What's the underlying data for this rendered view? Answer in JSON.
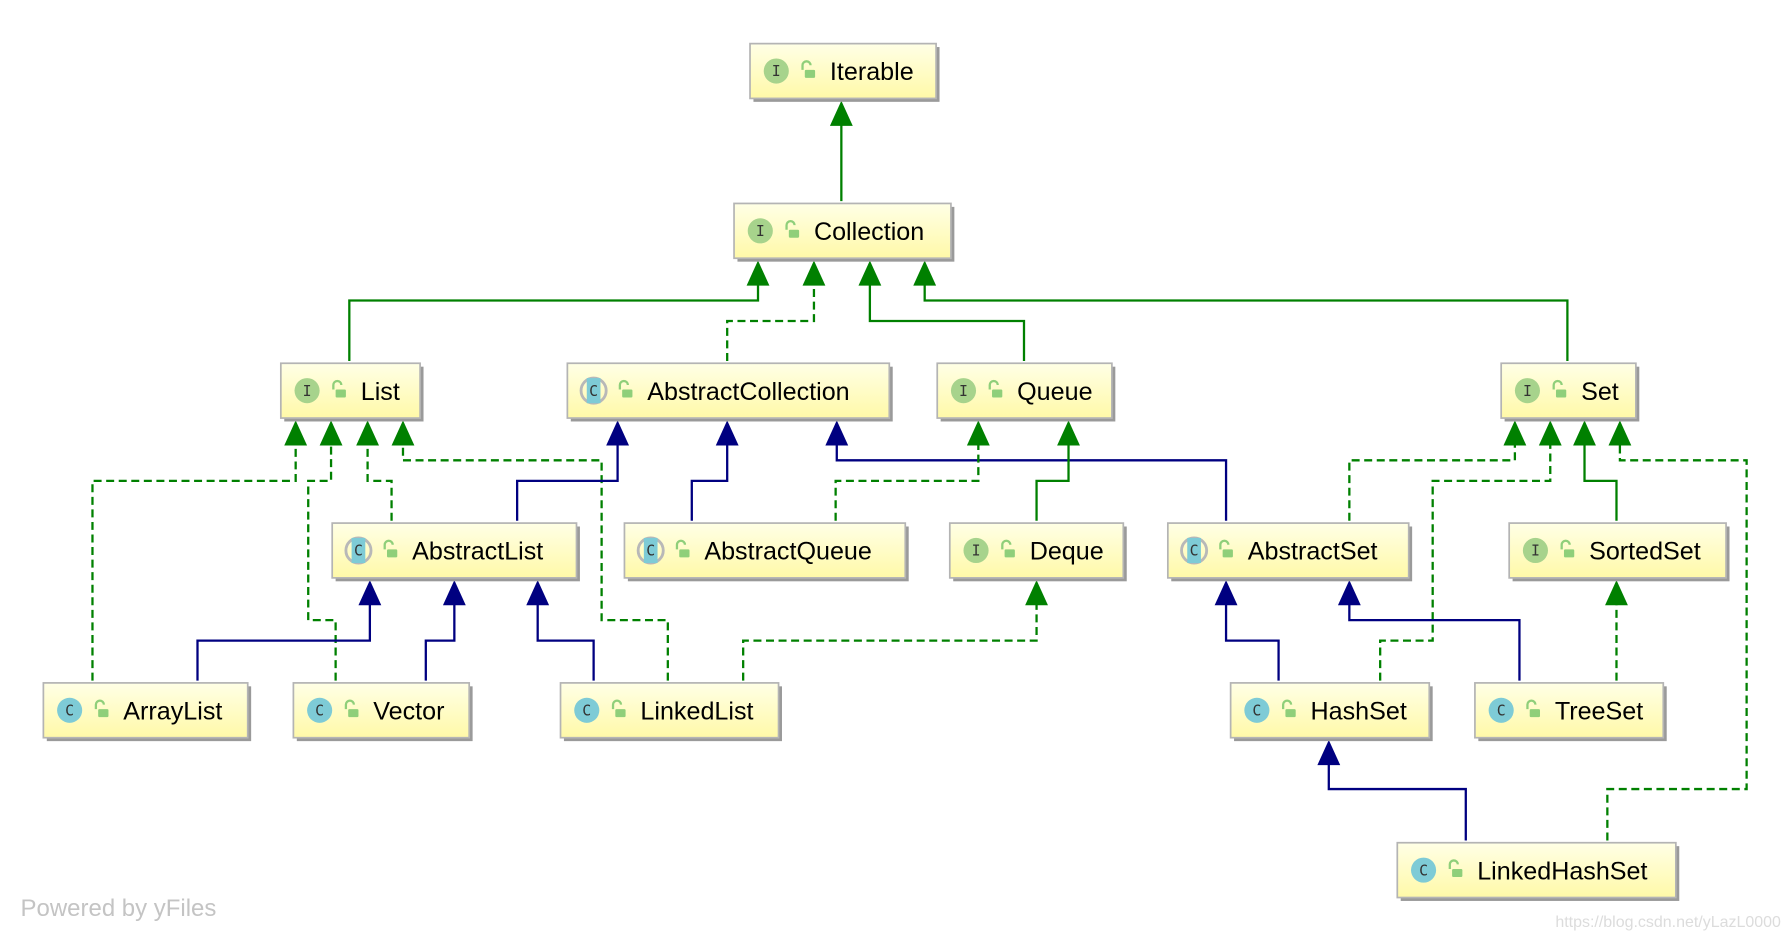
{
  "colors": {
    "implements_interface": "#008000",
    "extends_class": "#000080",
    "node_fill_top": "#ffffe6",
    "node_fill_bottom": "#fff9a8",
    "interface_icon": "#a7d38c",
    "class_icon": "#7ecbd6",
    "lock_icon": "#8fcf7a"
  },
  "nodes": [
    {
      "id": "Iterable",
      "label": "Iterable",
      "kind": "interface"
    },
    {
      "id": "Collection",
      "label": "Collection",
      "kind": "interface"
    },
    {
      "id": "List",
      "label": "List",
      "kind": "interface"
    },
    {
      "id": "AbstractCollection",
      "label": "AbstractCollection",
      "kind": "abstract-class"
    },
    {
      "id": "Queue",
      "label": "Queue",
      "kind": "interface"
    },
    {
      "id": "Set",
      "label": "Set",
      "kind": "interface"
    },
    {
      "id": "AbstractList",
      "label": "AbstractList",
      "kind": "abstract-class"
    },
    {
      "id": "AbstractQueue",
      "label": "AbstractQueue",
      "kind": "abstract-class"
    },
    {
      "id": "Deque",
      "label": "Deque",
      "kind": "interface"
    },
    {
      "id": "AbstractSet",
      "label": "AbstractSet",
      "kind": "abstract-class"
    },
    {
      "id": "SortedSet",
      "label": "SortedSet",
      "kind": "interface"
    },
    {
      "id": "ArrayList",
      "label": "ArrayList",
      "kind": "class"
    },
    {
      "id": "Vector",
      "label": "Vector",
      "kind": "class"
    },
    {
      "id": "LinkedList",
      "label": "LinkedList",
      "kind": "class"
    },
    {
      "id": "HashSet",
      "label": "HashSet",
      "kind": "class"
    },
    {
      "id": "TreeSet",
      "label": "TreeSet",
      "kind": "class"
    },
    {
      "id": "LinkedHashSet",
      "label": "LinkedHashSet",
      "kind": "class"
    }
  ],
  "icon_letters": {
    "interface": "I",
    "class": "C",
    "abstract-class": "C"
  },
  "edges": [
    {
      "from": "Collection",
      "to": "Iterable",
      "type": "interface-extends"
    },
    {
      "from": "List",
      "to": "Collection",
      "type": "interface-extends"
    },
    {
      "from": "AbstractCollection",
      "to": "Collection",
      "type": "implements"
    },
    {
      "from": "Queue",
      "to": "Collection",
      "type": "interface-extends"
    },
    {
      "from": "Set",
      "to": "Collection",
      "type": "interface-extends"
    },
    {
      "from": "ArrayList",
      "to": "List",
      "type": "implements"
    },
    {
      "from": "Vector",
      "to": "List",
      "type": "implements"
    },
    {
      "from": "AbstractList",
      "to": "List",
      "type": "implements"
    },
    {
      "from": "LinkedList",
      "to": "List",
      "type": "implements"
    },
    {
      "from": "AbstractList",
      "to": "AbstractCollection",
      "type": "extends"
    },
    {
      "from": "AbstractQueue",
      "to": "AbstractCollection",
      "type": "extends"
    },
    {
      "from": "AbstractSet",
      "to": "AbstractCollection",
      "type": "extends"
    },
    {
      "from": "AbstractQueue",
      "to": "Queue",
      "type": "implements"
    },
    {
      "from": "Deque",
      "to": "Queue",
      "type": "interface-extends"
    },
    {
      "from": "AbstractSet",
      "to": "Set",
      "type": "implements"
    },
    {
      "from": "HashSet",
      "to": "Set",
      "type": "implements"
    },
    {
      "from": "SortedSet",
      "to": "Set",
      "type": "interface-extends"
    },
    {
      "from": "LinkedHashSet",
      "to": "Set",
      "type": "implements"
    },
    {
      "from": "ArrayList",
      "to": "AbstractList",
      "type": "extends"
    },
    {
      "from": "Vector",
      "to": "AbstractList",
      "type": "extends"
    },
    {
      "from": "LinkedList",
      "to": "AbstractList",
      "type": "extends"
    },
    {
      "from": "LinkedList",
      "to": "Deque",
      "type": "implements"
    },
    {
      "from": "HashSet",
      "to": "AbstractSet",
      "type": "extends"
    },
    {
      "from": "TreeSet",
      "to": "AbstractSet",
      "type": "extends"
    },
    {
      "from": "TreeSet",
      "to": "SortedSet",
      "type": "implements"
    },
    {
      "from": "LinkedHashSet",
      "to": "HashSet",
      "type": "extends"
    }
  ],
  "footer": "Powered by yFiles",
  "watermark": "https://blog.csdn.net/yLazL0000"
}
